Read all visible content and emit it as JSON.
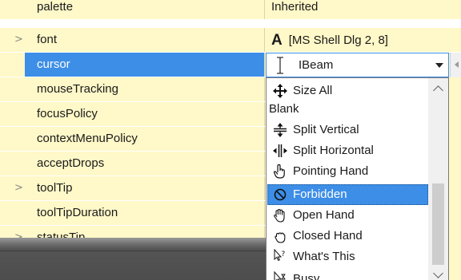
{
  "property_rows": [
    {
      "name": "palette",
      "value": "Inherited",
      "expander": ""
    },
    {
      "name": "font",
      "value": "[MS Shell Dlg 2, 8]",
      "value_prefix": "A",
      "expander": ">"
    },
    {
      "name": "cursor",
      "value": "",
      "expander": ""
    },
    {
      "name": "mouseTracking",
      "value": "",
      "expander": ""
    },
    {
      "name": "focusPolicy",
      "value": "",
      "expander": ""
    },
    {
      "name": "contextMenuPolicy",
      "value": "",
      "expander": ""
    },
    {
      "name": "acceptDrops",
      "value": "",
      "expander": ""
    },
    {
      "name": "toolTip",
      "value": "",
      "expander": ">"
    },
    {
      "name": "toolTipDuration",
      "value": "",
      "expander": ""
    },
    {
      "name": "statusTip",
      "value": "",
      "expander": ">"
    }
  ],
  "selected_row_index": 2,
  "cursor_combo": {
    "value": "IBeam",
    "icon": "ibeam-cursor-icon"
  },
  "cursor_options": [
    {
      "label": "Size All",
      "icon": "size-all-cursor-icon"
    },
    {
      "label": "Blank",
      "icon": ""
    },
    {
      "label": "Split Vertical",
      "icon": "split-vertical-cursor-icon"
    },
    {
      "label": "Split Horizontal",
      "icon": "split-horizontal-cursor-icon"
    },
    {
      "label": "Pointing Hand",
      "icon": "pointing-hand-cursor-icon"
    },
    {
      "label": "Forbidden",
      "icon": "forbidden-cursor-icon"
    },
    {
      "label": "Open Hand",
      "icon": "open-hand-cursor-icon"
    },
    {
      "label": "Closed Hand",
      "icon": "closed-hand-cursor-icon"
    },
    {
      "label": "What's This",
      "icon": "whats-this-cursor-icon"
    },
    {
      "label": "Busy",
      "icon": "busy-cursor-icon"
    }
  ],
  "selected_option_index": 5,
  "colors": {
    "row_background": "#fff8c8",
    "selection": "#3d8ee6",
    "text": "#1a1a1a"
  }
}
